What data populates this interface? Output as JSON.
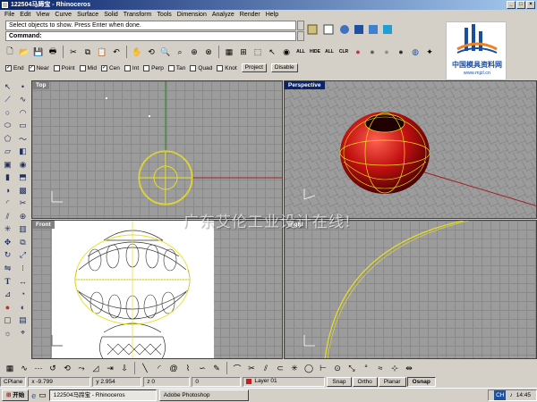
{
  "window": {
    "title": "122504马蹄宝 - Rhinoceros"
  },
  "menu": [
    "File",
    "Edit",
    "View",
    "Curve",
    "Surface",
    "Solid",
    "Transform",
    "Tools",
    "Dimension",
    "Analyze",
    "Render",
    "Help"
  ],
  "command": {
    "history": "Select objects to show. Press Enter when done.",
    "prompt": "Command:",
    "value": ""
  },
  "osnap": {
    "items": [
      {
        "label": "End",
        "checked": true
      },
      {
        "label": "Near",
        "checked": true
      },
      {
        "label": "Point",
        "checked": false
      },
      {
        "label": "Mid",
        "checked": false
      },
      {
        "label": "Cen",
        "checked": true
      },
      {
        "label": "Int",
        "checked": false
      },
      {
        "label": "Perp",
        "checked": false
      },
      {
        "label": "Tan",
        "checked": false
      },
      {
        "label": "Quad",
        "checked": false
      },
      {
        "label": "Knot",
        "checked": false
      }
    ],
    "project_label": "Project",
    "disable_label": "Disable"
  },
  "toolbar": {
    "text_buttons": [
      "ALL",
      "HIDE",
      "ALL",
      "CLR"
    ]
  },
  "viewports": {
    "top": "Top",
    "perspective": "Perspective",
    "front": "Front",
    "right": "Right"
  },
  "watermark": "广东艾伦工业设计在线!",
  "logo": {
    "text": "中国模具资料网",
    "url": "www.mjzl.cn"
  },
  "status": {
    "plane": "CPlane",
    "x": "x -9.799",
    "y": "y 2.954",
    "z": "z 0",
    "zero": "0",
    "layer": "Layer 01",
    "buttons": [
      {
        "label": "Snap",
        "on": false
      },
      {
        "label": "Ortho",
        "on": false
      },
      {
        "label": "Planar",
        "on": false
      },
      {
        "label": "Osnap",
        "on": true
      }
    ]
  },
  "taskbar": {
    "start": "开始",
    "tasks": [
      {
        "label": "122504马蹄宝 - Rhinoceros",
        "active": true
      },
      {
        "label": "Adobe Photoshop",
        "active": false
      }
    ],
    "time": "14:45"
  },
  "colors": {
    "title_blue": "#0a246a",
    "viewport_grid": "#9c9c9c",
    "curve_yellow": "#e8e020",
    "sphere_red": "#c01010",
    "x_axis": "#a02020",
    "y_axis": "#208020"
  }
}
